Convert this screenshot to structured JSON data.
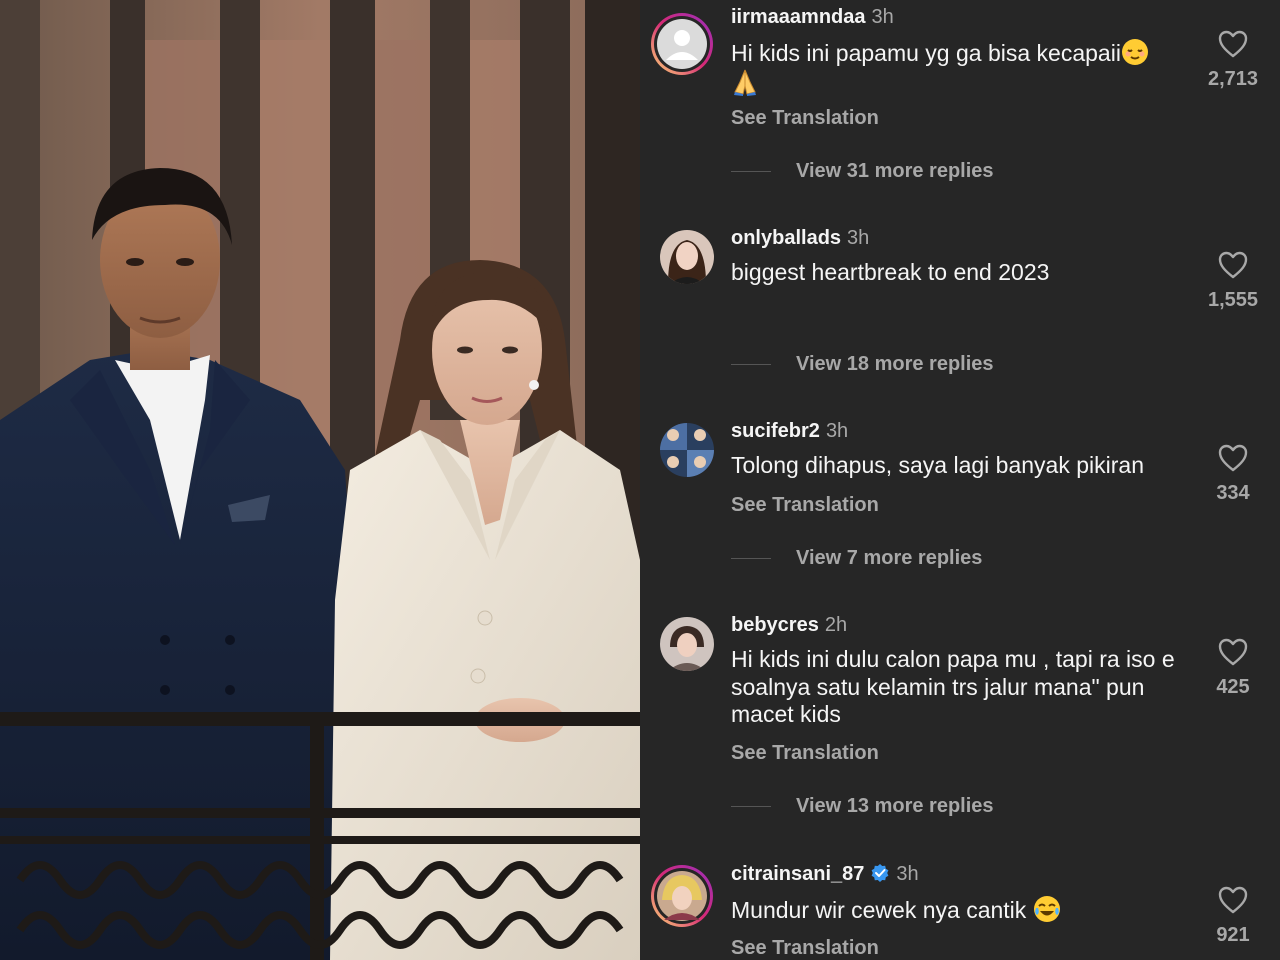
{
  "photo": {
    "description_icon": "photo-image"
  },
  "comments": [
    {
      "username": "iirmaaamndaa",
      "time": "3h",
      "text": "Hi kids ini papamu yg ga bisa kecapaii",
      "emojis": [
        "relieved-face-emoji",
        "folded-hands-emoji"
      ],
      "see_translation": "See Translation",
      "replies_label": "View 31 more replies",
      "likes": "2,713",
      "avatar_icon": "default-avatar-icon"
    },
    {
      "username": "onlyballads",
      "time": "3h",
      "text": "biggest heartbreak to end 2023",
      "replies_label": "View 18 more replies",
      "likes": "1,555"
    },
    {
      "username": "sucifebr2",
      "time": "3h",
      "text": "Tolong dihapus, saya lagi banyak pikiran",
      "see_translation": "See Translation",
      "replies_label": "View 7 more replies",
      "likes": "334"
    },
    {
      "username": "bebycres",
      "time": "2h",
      "text": "Hi kids ini dulu calon papa mu , tapi ra iso e soalnya satu kelamin trs jalur mana\" pun macet kids",
      "see_translation": "See Translation",
      "replies_label": "View 13 more replies",
      "likes": "425"
    },
    {
      "username": "citrainsani_87",
      "time": "3h",
      "verified": true,
      "text": "Mundur wir cewek nya cantik",
      "emojis": [
        "tears-of-joy-emoji"
      ],
      "see_translation": "See Translation",
      "likes": "921"
    }
  ],
  "colors": {
    "background": "#262626",
    "primary_text": "#f5f5f5",
    "secondary_text": "#a8a8a8",
    "verified_blue": "#3897f0",
    "story_ring": "#d6249f"
  }
}
